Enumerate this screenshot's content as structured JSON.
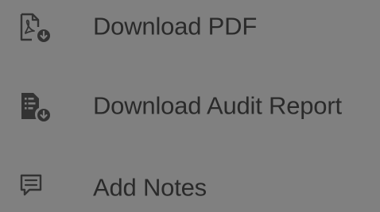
{
  "menu": {
    "items": [
      {
        "label": "Download PDF",
        "icon": "pdf-download-icon"
      },
      {
        "label": "Download Audit Report",
        "icon": "audit-report-download-icon"
      },
      {
        "label": "Add Notes",
        "icon": "add-notes-icon"
      }
    ]
  },
  "colors": {
    "background": "#808080",
    "text": "#2a2a2a",
    "icon": "#333333"
  }
}
